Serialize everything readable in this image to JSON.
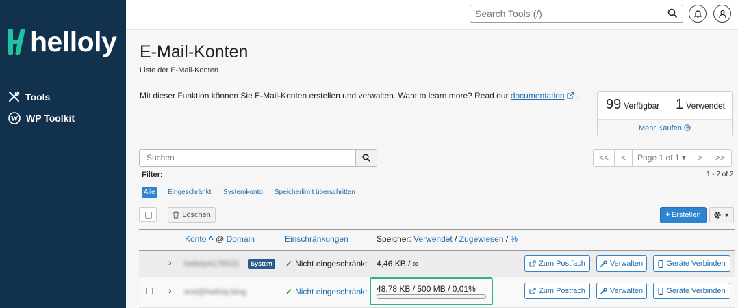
{
  "brand": {
    "name": "helloly",
    "accent": "#1fc49e",
    "sidebar_bg": "#12314d"
  },
  "sidebar": {
    "items": [
      {
        "label": "Tools",
        "icon": "tools-icon"
      },
      {
        "label": "WP Toolkit",
        "icon": "wordpress-icon"
      }
    ]
  },
  "topbar": {
    "search_placeholder": "Search Tools (/)"
  },
  "page": {
    "title": "E-Mail-Konten",
    "subtitle": "Liste der E-Mail-Konten",
    "intro_text": "Mit dieser Funktion können Sie E-Mail-Konten erstellen und verwalten. Want to learn more? Read our ",
    "intro_link": "documentation",
    "intro_end": " ."
  },
  "stats": {
    "available_num": "99",
    "available_label": "Verfügbar",
    "used_num": "1",
    "used_label": "Verwendet",
    "buy_more": "Mehr Kaufen"
  },
  "search": {
    "placeholder": "Suchen"
  },
  "pager": {
    "first": "<<",
    "prev": "<",
    "page": "Page 1 of 1",
    "next": ">",
    "last": ">>",
    "count": "1 - 2 of 2"
  },
  "filter": {
    "label": "Filter:",
    "chips": [
      "Alle",
      "Eingeschränkt",
      "Systemkonto",
      "Speicherlimit überschritten"
    ]
  },
  "actions": {
    "delete": "Löschen",
    "create": "Erstellen"
  },
  "table": {
    "col_account": "Konto",
    "col_at": "@",
    "col_domain": "Domain",
    "col_restrictions": "Einschränkungen",
    "col_storage_prefix": "Speicher:",
    "col_storage_used": "Verwendet",
    "col_storage_sep1": "/",
    "col_storage_assigned": "Zugewiesen",
    "col_storage_sep2": "/",
    "col_storage_pct": "%",
    "rows": [
      {
        "account": "helloly4176531",
        "badge": "System",
        "restriction": "Nicht eingeschränkt",
        "storage": "4,46 KB / ∞",
        "btn_mailbox": "Zum Postfach",
        "btn_manage": "Verwalten",
        "btn_devices": "Geräte Verbinden"
      },
      {
        "account": "test@helloly.blog",
        "restriction": "Nicht eingeschränkt",
        "storage": "48,78 KB / 500 MB / 0,01%",
        "usage_percent": 0.01,
        "btn_mailbox": "Zum Postfach",
        "btn_manage": "Verwalten",
        "btn_devices": "Geräte Verbinden"
      }
    ]
  }
}
